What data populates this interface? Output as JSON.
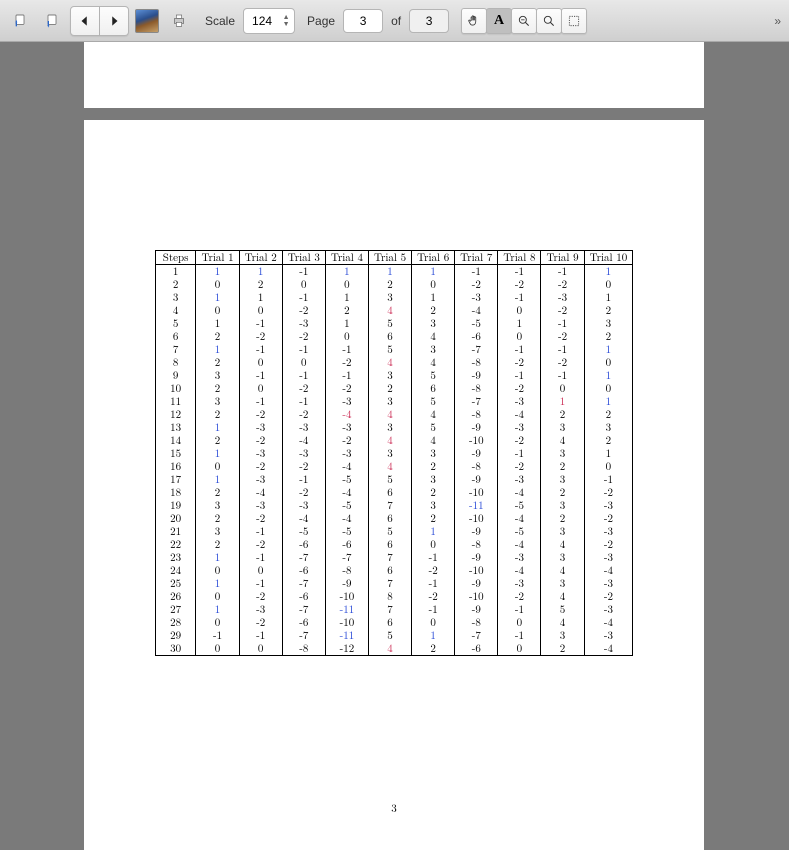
{
  "toolbar": {
    "scale_label": "Scale",
    "scale_value": "124",
    "page_label": "Page",
    "current_page": "3",
    "of_label": "of",
    "total_pages": "3"
  },
  "document": {
    "page_number": "3",
    "table": {
      "headers": [
        "Steps",
        "Trial 1",
        "Trial 2",
        "Trial 3",
        "Trial 4",
        "Trial 5",
        "Trial 6",
        "Trial 7",
        "Trial 8",
        "Trial 9",
        "Trial 10"
      ],
      "rows": [
        {
          "step": "1",
          "v": [
            {
              "t": "1",
              "c": "blue"
            },
            {
              "t": "1",
              "c": "blue"
            },
            {
              "t": "-1"
            },
            {
              "t": "1",
              "c": "blue"
            },
            {
              "t": "1",
              "c": "blue"
            },
            {
              "t": "1",
              "c": "blue"
            },
            {
              "t": "-1"
            },
            {
              "t": "-1"
            },
            {
              "t": "-1"
            },
            {
              "t": "1",
              "c": "blue"
            }
          ]
        },
        {
          "step": "2",
          "v": [
            {
              "t": "0"
            },
            {
              "t": "2"
            },
            {
              "t": "0"
            },
            {
              "t": "0"
            },
            {
              "t": "2"
            },
            {
              "t": "0"
            },
            {
              "t": "-2"
            },
            {
              "t": "-2"
            },
            {
              "t": "-2"
            },
            {
              "t": "0"
            }
          ]
        },
        {
          "step": "3",
          "v": [
            {
              "t": "1",
              "c": "blue"
            },
            {
              "t": "1"
            },
            {
              "t": "-1"
            },
            {
              "t": "1"
            },
            {
              "t": "3"
            },
            {
              "t": "1"
            },
            {
              "t": "-3"
            },
            {
              "t": "-1"
            },
            {
              "t": "-3"
            },
            {
              "t": "1"
            }
          ]
        },
        {
          "step": "4",
          "v": [
            {
              "t": "0"
            },
            {
              "t": "0"
            },
            {
              "t": "-2"
            },
            {
              "t": "2"
            },
            {
              "t": "4",
              "c": "pink"
            },
            {
              "t": "2"
            },
            {
              "t": "-4"
            },
            {
              "t": "0"
            },
            {
              "t": "-2"
            },
            {
              "t": "2"
            }
          ]
        },
        {
          "step": "5",
          "v": [
            {
              "t": "1"
            },
            {
              "t": "-1"
            },
            {
              "t": "-3"
            },
            {
              "t": "1"
            },
            {
              "t": "5"
            },
            {
              "t": "3"
            },
            {
              "t": "-5"
            },
            {
              "t": "1"
            },
            {
              "t": "-1"
            },
            {
              "t": "3"
            }
          ]
        },
        {
          "step": "6",
          "v": [
            {
              "t": "2"
            },
            {
              "t": "-2"
            },
            {
              "t": "-2"
            },
            {
              "t": "0"
            },
            {
              "t": "6"
            },
            {
              "t": "4"
            },
            {
              "t": "-6"
            },
            {
              "t": "0"
            },
            {
              "t": "-2"
            },
            {
              "t": "2"
            }
          ]
        },
        {
          "step": "7",
          "v": [
            {
              "t": "1",
              "c": "blue"
            },
            {
              "t": "-1"
            },
            {
              "t": "-1"
            },
            {
              "t": "-1"
            },
            {
              "t": "5"
            },
            {
              "t": "3"
            },
            {
              "t": "-7"
            },
            {
              "t": "-1"
            },
            {
              "t": "-1"
            },
            {
              "t": "1",
              "c": "blue"
            }
          ]
        },
        {
          "step": "8",
          "v": [
            {
              "t": "2"
            },
            {
              "t": "0"
            },
            {
              "t": "0"
            },
            {
              "t": "-2"
            },
            {
              "t": "4",
              "c": "pink"
            },
            {
              "t": "4"
            },
            {
              "t": "-8"
            },
            {
              "t": "-2"
            },
            {
              "t": "-2"
            },
            {
              "t": "0"
            }
          ]
        },
        {
          "step": "9",
          "v": [
            {
              "t": "3"
            },
            {
              "t": "-1"
            },
            {
              "t": "-1"
            },
            {
              "t": "-1"
            },
            {
              "t": "3"
            },
            {
              "t": "5"
            },
            {
              "t": "-9"
            },
            {
              "t": "-1"
            },
            {
              "t": "-1"
            },
            {
              "t": "1",
              "c": "blue"
            }
          ]
        },
        {
          "step": "10",
          "v": [
            {
              "t": "2"
            },
            {
              "t": "0"
            },
            {
              "t": "-2"
            },
            {
              "t": "-2"
            },
            {
              "t": "2"
            },
            {
              "t": "6"
            },
            {
              "t": "-8"
            },
            {
              "t": "-2"
            },
            {
              "t": "0"
            },
            {
              "t": "0"
            }
          ]
        },
        {
          "step": "11",
          "v": [
            {
              "t": "3"
            },
            {
              "t": "-1"
            },
            {
              "t": "-1"
            },
            {
              "t": "-3"
            },
            {
              "t": "3"
            },
            {
              "t": "5"
            },
            {
              "t": "-7"
            },
            {
              "t": "-3"
            },
            {
              "t": "1",
              "c": "pink"
            },
            {
              "t": "1",
              "c": "blue"
            }
          ]
        },
        {
          "step": "12",
          "v": [
            {
              "t": "2"
            },
            {
              "t": "-2"
            },
            {
              "t": "-2"
            },
            {
              "t": "-4",
              "c": "pink"
            },
            {
              "t": "4",
              "c": "pink"
            },
            {
              "t": "4"
            },
            {
              "t": "-8"
            },
            {
              "t": "-4"
            },
            {
              "t": "2"
            },
            {
              "t": "2"
            }
          ]
        },
        {
          "step": "13",
          "v": [
            {
              "t": "1",
              "c": "blue"
            },
            {
              "t": "-3"
            },
            {
              "t": "-3"
            },
            {
              "t": "-3"
            },
            {
              "t": "3"
            },
            {
              "t": "5"
            },
            {
              "t": "-9"
            },
            {
              "t": "-3"
            },
            {
              "t": "3"
            },
            {
              "t": "3"
            }
          ]
        },
        {
          "step": "14",
          "v": [
            {
              "t": "2"
            },
            {
              "t": "-2"
            },
            {
              "t": "-4"
            },
            {
              "t": "-2"
            },
            {
              "t": "4",
              "c": "pink"
            },
            {
              "t": "4"
            },
            {
              "t": "-10"
            },
            {
              "t": "-2"
            },
            {
              "t": "4"
            },
            {
              "t": "2"
            }
          ]
        },
        {
          "step": "15",
          "v": [
            {
              "t": "1",
              "c": "blue"
            },
            {
              "t": "-3"
            },
            {
              "t": "-3"
            },
            {
              "t": "-3"
            },
            {
              "t": "3"
            },
            {
              "t": "3"
            },
            {
              "t": "-9"
            },
            {
              "t": "-1"
            },
            {
              "t": "3"
            },
            {
              "t": "1"
            }
          ]
        },
        {
          "step": "16",
          "v": [
            {
              "t": "0"
            },
            {
              "t": "-2"
            },
            {
              "t": "-2"
            },
            {
              "t": "-4"
            },
            {
              "t": "4",
              "c": "pink"
            },
            {
              "t": "2"
            },
            {
              "t": "-8"
            },
            {
              "t": "-2"
            },
            {
              "t": "2"
            },
            {
              "t": "0"
            }
          ]
        },
        {
          "step": "17",
          "v": [
            {
              "t": "1",
              "c": "blue"
            },
            {
              "t": "-3"
            },
            {
              "t": "-1"
            },
            {
              "t": "-5"
            },
            {
              "t": "5"
            },
            {
              "t": "3"
            },
            {
              "t": "-9"
            },
            {
              "t": "-3"
            },
            {
              "t": "3"
            },
            {
              "t": "-1"
            }
          ]
        },
        {
          "step": "18",
          "v": [
            {
              "t": "2"
            },
            {
              "t": "-4"
            },
            {
              "t": "-2"
            },
            {
              "t": "-4"
            },
            {
              "t": "6"
            },
            {
              "t": "2"
            },
            {
              "t": "-10"
            },
            {
              "t": "-4"
            },
            {
              "t": "2"
            },
            {
              "t": "-2"
            }
          ]
        },
        {
          "step": "19",
          "v": [
            {
              "t": "3"
            },
            {
              "t": "-3"
            },
            {
              "t": "-3"
            },
            {
              "t": "-5"
            },
            {
              "t": "7"
            },
            {
              "t": "3"
            },
            {
              "t": "-11",
              "c": "blue"
            },
            {
              "t": "-5"
            },
            {
              "t": "3"
            },
            {
              "t": "-3"
            }
          ]
        },
        {
          "step": "20",
          "v": [
            {
              "t": "2"
            },
            {
              "t": "-2"
            },
            {
              "t": "-4"
            },
            {
              "t": "-4"
            },
            {
              "t": "6"
            },
            {
              "t": "2"
            },
            {
              "t": "-10"
            },
            {
              "t": "-4"
            },
            {
              "t": "2"
            },
            {
              "t": "-2"
            }
          ]
        },
        {
          "step": "21",
          "v": [
            {
              "t": "3"
            },
            {
              "t": "-1"
            },
            {
              "t": "-5"
            },
            {
              "t": "-5"
            },
            {
              "t": "5"
            },
            {
              "t": "1",
              "c": "blue"
            },
            {
              "t": "-9"
            },
            {
              "t": "-5"
            },
            {
              "t": "3"
            },
            {
              "t": "-3"
            }
          ]
        },
        {
          "step": "22",
          "v": [
            {
              "t": "2"
            },
            {
              "t": "-2"
            },
            {
              "t": "-6"
            },
            {
              "t": "-6"
            },
            {
              "t": "6"
            },
            {
              "t": "0"
            },
            {
              "t": "-8"
            },
            {
              "t": "-4"
            },
            {
              "t": "4"
            },
            {
              "t": "-2"
            }
          ]
        },
        {
          "step": "23",
          "v": [
            {
              "t": "1",
              "c": "blue"
            },
            {
              "t": "-1"
            },
            {
              "t": "-7"
            },
            {
              "t": "-7"
            },
            {
              "t": "7"
            },
            {
              "t": "-1"
            },
            {
              "t": "-9"
            },
            {
              "t": "-3"
            },
            {
              "t": "3"
            },
            {
              "t": "-3"
            }
          ]
        },
        {
          "step": "24",
          "v": [
            {
              "t": "0"
            },
            {
              "t": "0"
            },
            {
              "t": "-6"
            },
            {
              "t": "-8"
            },
            {
              "t": "6"
            },
            {
              "t": "-2"
            },
            {
              "t": "-10"
            },
            {
              "t": "-4"
            },
            {
              "t": "4"
            },
            {
              "t": "-4"
            }
          ]
        },
        {
          "step": "25",
          "v": [
            {
              "t": "1",
              "c": "blue"
            },
            {
              "t": "-1"
            },
            {
              "t": "-7"
            },
            {
              "t": "-9"
            },
            {
              "t": "7"
            },
            {
              "t": "-1"
            },
            {
              "t": "-9"
            },
            {
              "t": "-3"
            },
            {
              "t": "3"
            },
            {
              "t": "-3"
            }
          ]
        },
        {
          "step": "26",
          "v": [
            {
              "t": "0"
            },
            {
              "t": "-2"
            },
            {
              "t": "-6"
            },
            {
              "t": "-10"
            },
            {
              "t": "8"
            },
            {
              "t": "-2"
            },
            {
              "t": "-10"
            },
            {
              "t": "-2"
            },
            {
              "t": "4"
            },
            {
              "t": "-2"
            }
          ]
        },
        {
          "step": "27",
          "v": [
            {
              "t": "1",
              "c": "blue"
            },
            {
              "t": "-3"
            },
            {
              "t": "-7"
            },
            {
              "t": "-11",
              "c": "blue"
            },
            {
              "t": "7"
            },
            {
              "t": "-1"
            },
            {
              "t": "-9"
            },
            {
              "t": "-1"
            },
            {
              "t": "5"
            },
            {
              "t": "-3"
            }
          ]
        },
        {
          "step": "28",
          "v": [
            {
              "t": "0"
            },
            {
              "t": "-2"
            },
            {
              "t": "-6"
            },
            {
              "t": "-10"
            },
            {
              "t": "6"
            },
            {
              "t": "0"
            },
            {
              "t": "-8"
            },
            {
              "t": "0"
            },
            {
              "t": "4"
            },
            {
              "t": "-4"
            }
          ]
        },
        {
          "step": "29",
          "v": [
            {
              "t": "-1"
            },
            {
              "t": "-1"
            },
            {
              "t": "-7"
            },
            {
              "t": "-11",
              "c": "blue"
            },
            {
              "t": "5"
            },
            {
              "t": "1",
              "c": "blue"
            },
            {
              "t": "-7"
            },
            {
              "t": "-1"
            },
            {
              "t": "3"
            },
            {
              "t": "-3"
            }
          ]
        },
        {
          "step": "30",
          "v": [
            {
              "t": "0"
            },
            {
              "t": "0"
            },
            {
              "t": "-8"
            },
            {
              "t": "-12"
            },
            {
              "t": "4",
              "c": "pink"
            },
            {
              "t": "2"
            },
            {
              "t": "-6"
            },
            {
              "t": "0"
            },
            {
              "t": "2"
            },
            {
              "t": "-4"
            }
          ]
        }
      ]
    }
  }
}
